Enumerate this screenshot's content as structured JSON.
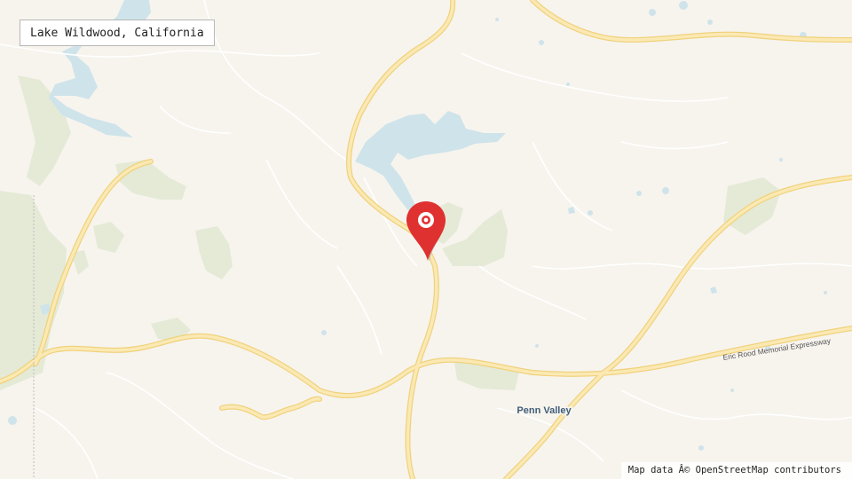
{
  "map": {
    "title": "Lake Wildwood, California",
    "attribution": "Map data Â© OpenStreetMap contributors",
    "place_labels": [
      "Penn Valley"
    ],
    "road_labels": [
      "Eric Rood Memorial Expressway"
    ],
    "marker": {
      "icon": "map-pin-icon",
      "color": "#e03131"
    },
    "colors": {
      "land": "#f7f4ee",
      "water": "#cfe3ea",
      "park": "#e4ead6",
      "highway": "#fbe29a",
      "minor_road": "#ffffff",
      "place_label": "#3f5e7a"
    }
  }
}
